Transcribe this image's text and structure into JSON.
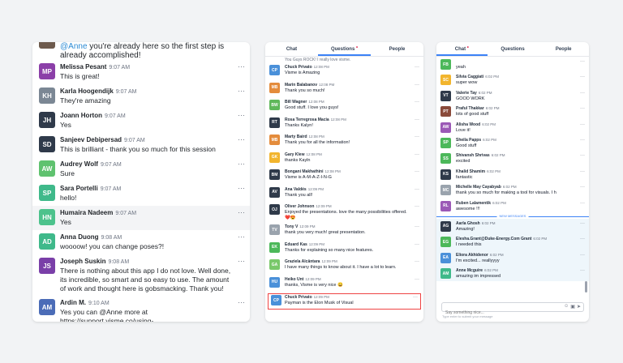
{
  "panel_left": {
    "top_message": {
      "mention": "@Anne",
      "text": " you're already here so the first step is already accomplished!"
    },
    "messages": [
      {
        "initials": "MP",
        "color": "#8b3fa8",
        "name": "Melissa Pesant",
        "time": "9:07 AM",
        "text": "This is great!",
        "highlight": false
      },
      {
        "initials": "KH",
        "color": "#7b8794",
        "name": "Karla Hoogendijk",
        "time": "9:07 AM",
        "text": "They're amazing",
        "highlight": false
      },
      {
        "initials": "JH",
        "color": "#2f3a4a",
        "name": "Joann Horton",
        "time": "9:07 AM",
        "text": "Yes",
        "highlight": false
      },
      {
        "initials": "SD",
        "color": "#2f3a4a",
        "name": "Sanjeev Debipersad",
        "time": "9:07 AM",
        "text": "This is brilliant - thank you so much for this session",
        "highlight": false
      },
      {
        "initials": "AW",
        "color": "#5fc26f",
        "name": "Audrey Wolf",
        "time": "9:07 AM",
        "text": "Sure",
        "highlight": false
      },
      {
        "initials": "SP",
        "color": "#3fb98a",
        "name": "Sara Portelli",
        "time": "9:07 AM",
        "text": "hello!",
        "highlight": false
      },
      {
        "initials": "HN",
        "color": "#4cc28c",
        "name": "Humaira Nadeem",
        "time": "9:07 AM",
        "text": "Yes",
        "highlight": true
      },
      {
        "initials": "AD",
        "color": "#3fb98a",
        "name": "Anna Duong",
        "time": "9:08 AM",
        "text": "woooow! you can change poses?!",
        "highlight": false
      },
      {
        "initials": "JS",
        "color": "#7a3fa8",
        "name": "Joseph Suskin",
        "time": "9:08 AM",
        "text": "There is nothing about this app I do not love. Well done, its incredible, so smart and so easy to use. The amount of work and thought here is gobsmacking. Thank you!",
        "highlight": false
      },
      {
        "initials": "AM",
        "color": "#4b6cb7",
        "name": "Ardin M.",
        "time": "9:10 AM",
        "text": "Yes you can @Anne more at https://support.visme.co/using-",
        "highlight": false
      }
    ]
  },
  "panel_middle": {
    "tabs": [
      {
        "label": "Chat",
        "active": false,
        "dot": false
      },
      {
        "label": "Questions",
        "active": true,
        "dot": true
      },
      {
        "label": "People",
        "active": false,
        "dot": false
      }
    ],
    "top_partial": "You Guys ROCK! I really love visme.",
    "rows": [
      {
        "initials": "CP",
        "color": "#4a90d9",
        "name": "Chuck Privato",
        "time": "12:08 PM",
        "text": "Visme is Amazing",
        "selected": false
      },
      {
        "initials": "MB",
        "color": "#e48c3c",
        "name": "Marin Balabanov",
        "time": "12:08 PM",
        "text": "Thank you so much!",
        "selected": false
      },
      {
        "initials": "BW",
        "color": "#5fb85a",
        "name": "Bill Wagner",
        "time": "12:08 PM",
        "text": "Good stuff. I love you guys!",
        "selected": false
      },
      {
        "initials": "RT",
        "color": "#2f3a4a",
        "name": "Rosa Terregrosa Macia",
        "time": "12:08 PM",
        "text": "Thanks Kalyn!",
        "selected": false
      },
      {
        "initials": "MB",
        "color": "#e48c3c",
        "name": "Marty Baird",
        "time": "12:08 PM",
        "text": "Thank you for all the information!",
        "selected": false
      },
      {
        "initials": "GK",
        "color": "#f2b52e",
        "name": "Gary Klew",
        "time": "12:08 PM",
        "text": "thanks Kayln",
        "selected": false
      },
      {
        "initials": "BM",
        "color": "#2f3a4a",
        "name": "Bongani Makhathini",
        "time": "12:08 PM",
        "text": "Visme is A-M-A-Z-I-N-G",
        "selected": false
      },
      {
        "initials": "AV",
        "color": "#2f3a4a",
        "name": "Ana Valdés",
        "time": "12:09 PM",
        "text": "Thank you all!",
        "selected": false
      },
      {
        "initials": "OJ",
        "color": "#2f3a4a",
        "name": "Oliver Johnson",
        "time": "12:09 PM",
        "text": "Enjoyed the presentations. love the many possibilities offered. ❤️😍",
        "selected": false
      },
      {
        "initials": "TV",
        "color": "#9aa3ad",
        "name": "Tony V",
        "time": "12:09 PM",
        "text": "thank you very much! great presentation.",
        "selected": false
      },
      {
        "initials": "EK",
        "color": "#4cb85a",
        "name": "Eduard Kas",
        "time": "12:09 PM",
        "text": "Thanks for explaining so many nice features.",
        "selected": false
      },
      {
        "initials": "GA",
        "color": "#79c86a",
        "name": "Graziela Alcântara",
        "time": "12:09 PM",
        "text": "I have many things to know about it. I have a lot to learn.",
        "selected": false
      },
      {
        "initials": "HU",
        "color": "#4a90d9",
        "name": "Heiko Unt",
        "time": "12:09 PM",
        "text": "thanks, Visme is very nice 😀",
        "selected": false
      },
      {
        "initials": "CP",
        "color": "#4a90d9",
        "name": "Chuck Privato",
        "time": "12:09 PM",
        "text": "Payman is the Elon Musk of Visual",
        "selected": true
      }
    ]
  },
  "panel_right": {
    "tabs": [
      {
        "label": "Chat",
        "active": true,
        "dot": true
      },
      {
        "label": "Questions",
        "active": false,
        "dot": false
      },
      {
        "label": "People",
        "active": false,
        "dot": false
      }
    ],
    "rows_before": [
      {
        "initials": "FB",
        "color": "#4cb85a",
        "name": "",
        "time": "",
        "text": "yeah"
      },
      {
        "initials": "SC",
        "color": "#f2b52e",
        "name": "Silvia Caggiati",
        "time": "6:02 PM",
        "text": "super wow"
      },
      {
        "initials": "VT",
        "color": "#2f3a4a",
        "name": "Valerie Tay",
        "time": "6:02 PM",
        "text": "GOOD WORK"
      },
      {
        "initials": "PT",
        "color": "#8a4a3a",
        "name": "Praful Thakkar",
        "time": "6:02 PM",
        "text": "lots of good stuff"
      },
      {
        "initials": "AW",
        "color": "#9b59b6",
        "name": "Alisha Wood",
        "time": "6:02 PM",
        "text": "Love it!"
      },
      {
        "initials": "SP",
        "color": "#4cb85a",
        "name": "Sheila Papps",
        "time": "6:02 PM",
        "text": "Good stuff"
      },
      {
        "initials": "SS",
        "color": "#4cb85a",
        "name": "Shivansh Shrivas",
        "time": "6:02 PM",
        "text": "excited"
      },
      {
        "initials": "KS",
        "color": "#2f3a4a",
        "name": "Khalid Shamim",
        "time": "6:02 PM",
        "text": "fantastic"
      },
      {
        "initials": "MC",
        "color": "#9aa3ad",
        "name": "Michelle May Cayabyab",
        "time": "6:02 PM",
        "text": "thank you so much for making a tool for visuals. I h"
      },
      {
        "initials": "RL",
        "color": "#9b59b6",
        "name": "Ruben Lalamentik",
        "time": "6:02 PM",
        "text": "awesome !!!"
      }
    ],
    "new_messages_label": "NEW MESSAGES",
    "rows_after": [
      {
        "initials": "AG",
        "color": "#2f3a4a",
        "name": "Aarla Ghosh",
        "time": "6:02 PM",
        "text": "Amazing!"
      },
      {
        "initials": "EG",
        "color": "#4cb85a",
        "name": "Elesha.Grant@Duke-Energy.Com Grant",
        "time": "6:02 PM",
        "text": "I needed this"
      },
      {
        "initials": "EA",
        "color": "#4a90d9",
        "name": "Eliora Akhidenor",
        "time": "6:02 PM",
        "text": "I'm excited... reallyyyy"
      },
      {
        "initials": "AM",
        "color": "#3fb98a",
        "name": "Anne Mcguire",
        "time": "6:02 PM",
        "text": "amazing im impressed"
      }
    ],
    "composer_placeholder": "Say something nice...",
    "hint": "Type enter to submit your message"
  },
  "dots": "···"
}
